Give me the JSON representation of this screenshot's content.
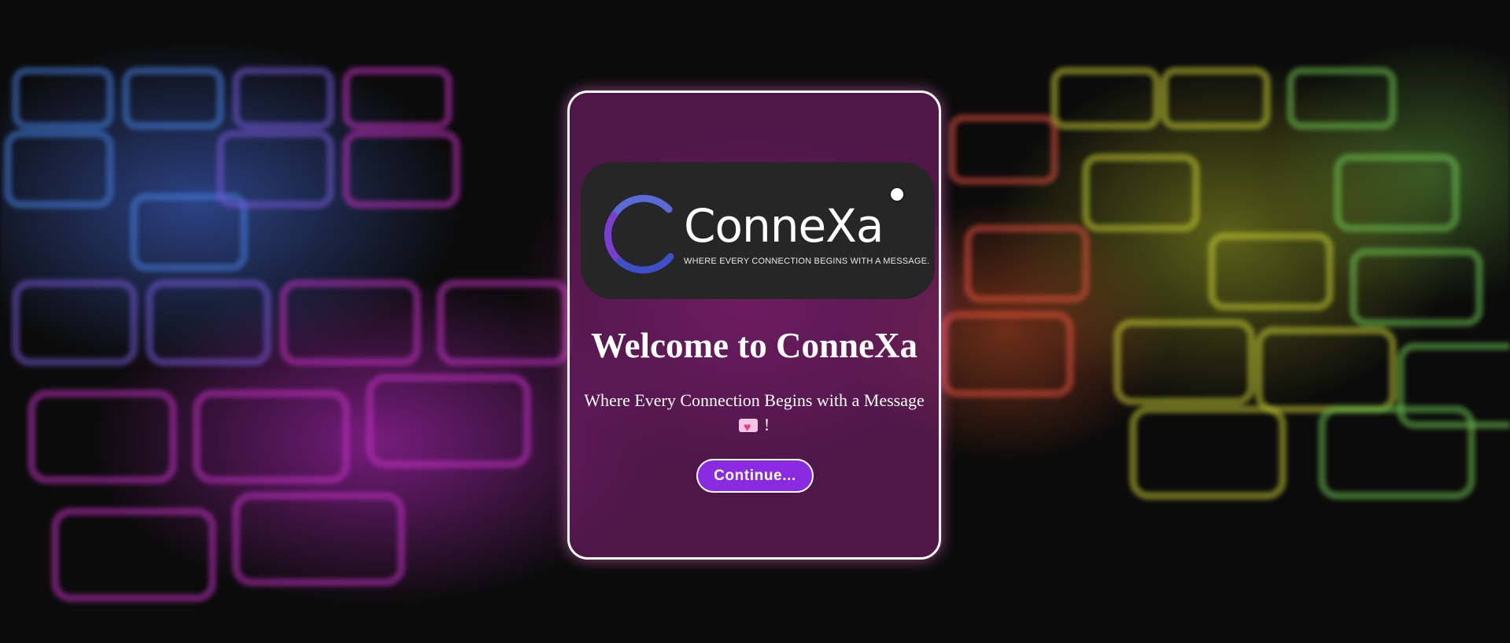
{
  "background": {
    "description_icon": "keyboard-background-icon",
    "accent_colors": [
      "#3a7bd5",
      "#c43ad5",
      "#e0573a",
      "#c8d23a",
      "#6cc85a"
    ]
  },
  "card": {
    "border_color": "#ffffff",
    "tint_color": "#781e6e"
  },
  "logo": {
    "name": "ConneXa",
    "tagline": "WHERE EVERY CONNECTION BEGINS WITH A MESSAGE.",
    "mark_colors": [
      "#5a6ad8",
      "#7a3fd0",
      "#3f4fc8"
    ]
  },
  "welcome": {
    "title": "Welcome to ConneXa",
    "subtitle_line1": "Where Every Connection Begins with a Message",
    "subtitle_line2_suffix": "!"
  },
  "continue_button": {
    "label": "Continue...",
    "color": "#8a2be2"
  }
}
